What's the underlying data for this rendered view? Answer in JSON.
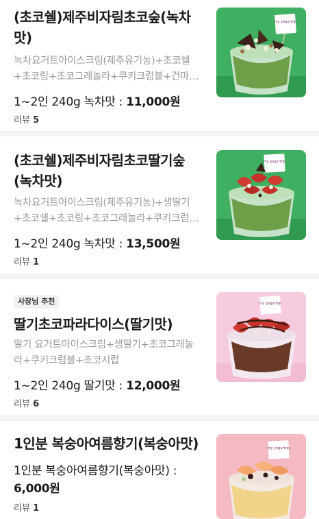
{
  "items": [
    {
      "title": "(초코쉘)제주비자림초코숲(녹차맛)",
      "description": "녹차요거트아이스크림(제주유기농)+초코쉘+초코링+초코그래놀라+쿠키크럼블+건마…",
      "price_label": "1~2인 240g 녹차맛 : ",
      "price_value": "11,000원",
      "review_label": "리뷰 ",
      "review_count": "5",
      "image": {
        "name": "matcha-chocolate-forest-bowl",
        "bg": "#3fb061",
        "accent": "#4e8f2a"
      }
    },
    {
      "title": "(초코쉘)제주비자림초코딸기숲(녹차맛)",
      "description": "녹차요거트아이스크림(제주유기농)+생딸기+초코쉘+초코링+초코그래놀라+쿠키크럼…",
      "price_label": "1~2인 240g  녹차맛 : ",
      "price_value": "13,500원",
      "review_label": "리뷰 ",
      "review_count": "1",
      "image": {
        "name": "matcha-strawberry-chocolate-bowl",
        "bg": "#3fb061",
        "accent": "#c8302a"
      }
    },
    {
      "badge": "사장님 추천",
      "title": "딸기초코파라다이스(딸기맛)",
      "description": "딸기 요거트아이스크림+생딸기+초코그래놀라+쿠키크럼블+초코시럽",
      "price_label": "1~2인 240g  딸기맛 : ",
      "price_value": "12,000원",
      "review_label": "리뷰 ",
      "review_count": "6",
      "image": {
        "name": "strawberry-chocolate-paradise-bowl",
        "bg": "#f6cbe0",
        "accent": "#c8302a"
      }
    },
    {
      "title": "1인분 복숭아여름향기(복숭아맛)",
      "description": "1인분 복숭아여름향기(복숭아맛) :",
      "price_value": "6,000원",
      "review_label": "리뷰 ",
      "review_count": "1",
      "image": {
        "name": "peach-summer-bowl",
        "bg": "#f4b9c2",
        "accent": "#f4a56b"
      }
    }
  ],
  "image_sign_text": "my yogurtrip"
}
